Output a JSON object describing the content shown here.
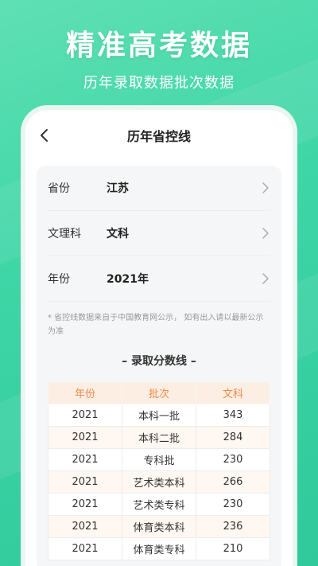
{
  "promo": {
    "headline": "精准高考数据",
    "subheadline": "历年录取数据批次数据"
  },
  "nav": {
    "title": "历年省控线"
  },
  "filters": [
    {
      "label": "省份",
      "value": "江苏"
    },
    {
      "label": "文理科",
      "value": "文科"
    },
    {
      "label": "年份",
      "value": "2021年"
    }
  ],
  "note": "* 省控线数据来自于中国教育网公示， 如有出入请以最新公示为准",
  "section_title": "– 录取分数线 –",
  "table": {
    "headers": [
      "年份",
      "批次",
      "文科"
    ],
    "rows": [
      [
        "2021",
        "本科一批",
        "343"
      ],
      [
        "2021",
        "本科二批",
        "284"
      ],
      [
        "2021",
        "专科批",
        "230"
      ],
      [
        "2021",
        "艺术类本科",
        "266"
      ],
      [
        "2021",
        "艺术类专科",
        "230"
      ],
      [
        "2021",
        "体育类本科",
        "236"
      ],
      [
        "2021",
        "体育类专科",
        "210"
      ]
    ]
  },
  "colors": {
    "accent_green": "#3fd6a6",
    "table_header_bg": "#fdeee3",
    "table_header_text": "#f08a47"
  },
  "icons": {
    "back": "chevron-left-icon",
    "row_arrow": "chevron-right-icon"
  }
}
